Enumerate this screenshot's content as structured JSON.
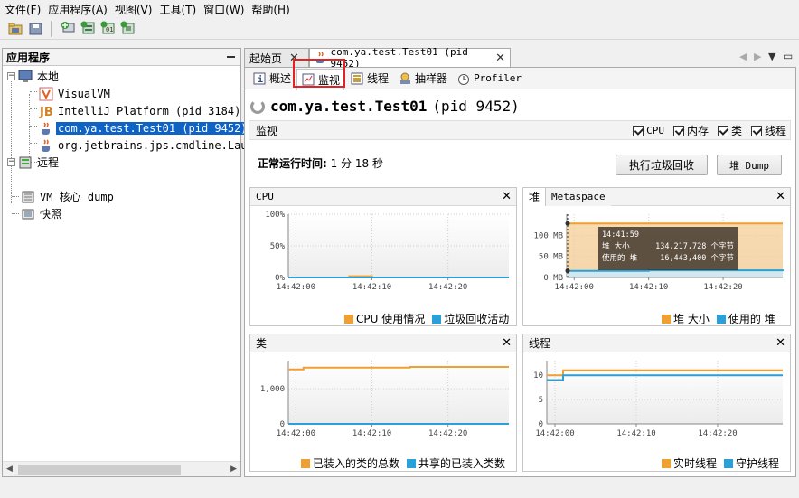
{
  "menu": [
    "文件(F)",
    "应用程序(A)",
    "视图(V)",
    "工具(T)",
    "窗口(W)",
    "帮助(H)"
  ],
  "left_panel": {
    "title": "应用程序",
    "local": "本地",
    "apps": [
      "VisualVM",
      "IntelliJ Platform (pid 3184)",
      "com.ya.test.Test01 (pid 9452)",
      "org.jetbrains.jps.cmdline.Launcher"
    ],
    "remote": "远程",
    "core_dump": "VM 核心 dump",
    "snapshots": "快照"
  },
  "doc_tabs": {
    "start": "起始页",
    "app": "com.ya.test.Test01 (pid 9452)"
  },
  "sub_tabs": [
    "概述",
    "监视",
    "线程",
    "抽样器",
    "Profiler"
  ],
  "page": {
    "app_name": "com.ya.test.Test01",
    "pid": "(pid 9452)",
    "section": "监视",
    "checks": [
      "CPU",
      "内存",
      "类",
      "线程"
    ],
    "uptime_label": "正常运行时间:",
    "uptime_value": "1 分 18 秒",
    "gc_button": "执行垃圾回收",
    "heap_dump_button": "堆 Dump"
  },
  "panels": {
    "cpu": {
      "title": "CPU",
      "legend": [
        "CPU 使用情况",
        "垃圾回收活动"
      ]
    },
    "heap": {
      "tab_heap": "堆",
      "tab_meta": "Metaspace",
      "legend": [
        "堆 大小",
        "使用的 堆"
      ],
      "tooltip": {
        "time": "14:41:59",
        "rows": [
          [
            "堆 大小",
            "134,217,728 个字节"
          ],
          [
            "使用的 堆",
            "16,443,400 个字节"
          ]
        ]
      }
    },
    "classes": {
      "title": "类",
      "legend": [
        "已装入的类的总数",
        "共享的已装入类数"
      ]
    },
    "threads": {
      "title": "线程",
      "legend": [
        "实时线程",
        "守护线程"
      ]
    }
  },
  "colors": {
    "orange": "#f0a030",
    "blue": "#2aa0d8",
    "selection": "#0e63c4",
    "highlight": "#e52222"
  },
  "chart_data": [
    {
      "type": "line",
      "title": "CPU",
      "x": [
        "14:41:59",
        "14:42:00",
        "14:42:03",
        "14:42:05",
        "14:42:07",
        "14:42:10",
        "14:42:15",
        "14:42:20",
        "14:42:25",
        "14:42:28"
      ],
      "xticks": [
        "14:42:00",
        "14:42:10",
        "14:42:20"
      ],
      "yticks": [
        "0%",
        "50%",
        "100%"
      ],
      "ylim": [
        0,
        100
      ],
      "series": [
        {
          "name": "CPU 使用情况",
          "values": [
            0,
            0,
            0,
            0,
            2,
            0,
            0,
            0,
            0,
            0
          ]
        },
        {
          "name": "垃圾回收活动",
          "values": [
            0,
            0,
            0,
            0,
            0,
            0,
            0,
            0,
            0,
            0
          ]
        }
      ]
    },
    {
      "type": "area",
      "title": "堆",
      "x": [
        "14:41:59",
        "14:42:00",
        "14:42:05",
        "14:42:10",
        "14:42:15",
        "14:42:20",
        "14:42:25",
        "14:42:28"
      ],
      "xticks": [
        "14:42:00",
        "14:42:10",
        "14:42:20"
      ],
      "yticks": [
        "0 MB",
        "50 MB",
        "100 MB"
      ],
      "ylim": [
        0,
        150
      ],
      "series": [
        {
          "name": "堆 大小",
          "values": [
            128,
            128,
            128,
            128,
            128,
            128,
            128,
            128
          ]
        },
        {
          "name": "使用的 堆",
          "values": [
            15.7,
            15.7,
            15.7,
            17,
            17,
            17,
            17,
            19
          ]
        }
      ]
    },
    {
      "type": "line",
      "title": "类",
      "x": [
        "14:41:59",
        "14:42:01",
        "14:42:10",
        "14:42:15",
        "14:42:20",
        "14:42:28"
      ],
      "xticks": [
        "14:42:00",
        "14:42:10",
        "14:42:20"
      ],
      "yticks": [
        "0",
        "1,000"
      ],
      "ylim": [
        0,
        1800
      ],
      "series": [
        {
          "name": "已装入的类的总数",
          "values": [
            1550,
            1600,
            1600,
            1620,
            1620,
            1620
          ]
        },
        {
          "name": "共享的已装入类数",
          "values": [
            0,
            0,
            0,
            0,
            0,
            0
          ]
        }
      ]
    },
    {
      "type": "line",
      "title": "线程",
      "x": [
        "14:41:59",
        "14:42:01",
        "14:42:10",
        "14:42:20",
        "14:42:28"
      ],
      "xticks": [
        "14:42:00",
        "14:42:10",
        "14:42:20"
      ],
      "yticks": [
        "0",
        "5",
        "10"
      ],
      "ylim": [
        0,
        13
      ],
      "series": [
        {
          "name": "实时线程",
          "values": [
            10,
            11,
            11,
            11,
            11
          ]
        },
        {
          "name": "守护线程",
          "values": [
            9,
            10,
            10,
            10,
            10
          ]
        }
      ]
    }
  ]
}
